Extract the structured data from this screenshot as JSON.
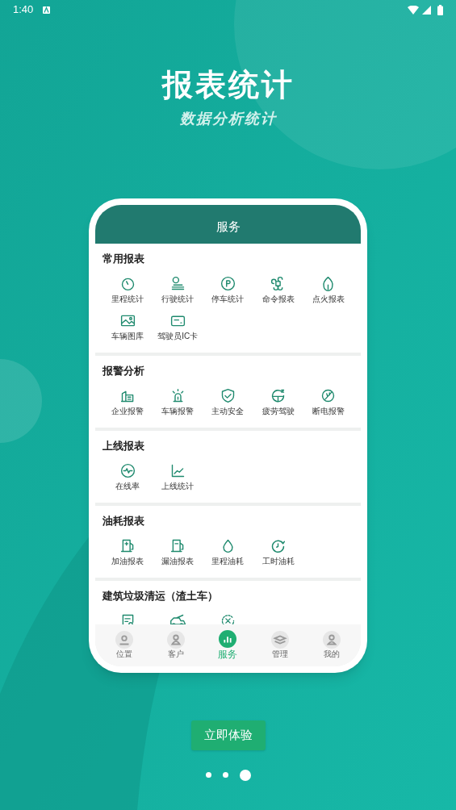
{
  "status_bar": {
    "time": "1:40"
  },
  "headline": {
    "title": "报表统计",
    "subtitle": "数据分析统计"
  },
  "phone": {
    "header": "服务",
    "sections": [
      {
        "title": "常用报表",
        "items": [
          {
            "kind": "labeled",
            "label": "里程统计"
          },
          {
            "kind": "labeled",
            "label": "行驶统计"
          },
          {
            "kind": "labeled",
            "label": "停车统计"
          },
          {
            "kind": "labeled",
            "label": "命令报表"
          },
          {
            "kind": "labeled",
            "label": "点火报表"
          },
          {
            "kind": "labeled",
            "label": "车辆图库"
          },
          {
            "kind": "labeled",
            "label": "驾驶员IC卡"
          }
        ]
      },
      {
        "title": "报警分析",
        "items": [
          {
            "kind": "labeled",
            "label": "企业报警"
          },
          {
            "kind": "labeled",
            "label": "车辆报警"
          },
          {
            "kind": "labeled",
            "label": "主动安全"
          },
          {
            "kind": "labeled",
            "label": "疲劳驾驶"
          },
          {
            "kind": "labeled",
            "label": "断电报警"
          }
        ]
      },
      {
        "title": "上线报表",
        "items": [
          {
            "kind": "labeled",
            "label": "在线率"
          },
          {
            "kind": "labeled",
            "label": "上线统计"
          }
        ]
      },
      {
        "title": "油耗报表",
        "items": [
          {
            "kind": "labeled",
            "label": "加油报表"
          },
          {
            "kind": "labeled",
            "label": "漏油报表"
          },
          {
            "kind": "labeled",
            "label": "里程油耗"
          },
          {
            "kind": "labeled",
            "label": "工时油耗"
          }
        ]
      },
      {
        "title": "建筑垃圾清运（渣土车）",
        "items": [
          {
            "kind": "icon_only"
          },
          {
            "kind": "icon_only"
          },
          {
            "kind": "icon_only"
          }
        ]
      }
    ],
    "nav": [
      {
        "label": "位置",
        "selected": false
      },
      {
        "label": "客户",
        "selected": false
      },
      {
        "label": "服务",
        "selected": true
      },
      {
        "label": "管理",
        "selected": false
      },
      {
        "label": "我的",
        "selected": false
      }
    ]
  },
  "cta": "立即体验",
  "pager": [
    {
      "selected": false
    },
    {
      "selected": false
    },
    {
      "selected": true
    }
  ]
}
